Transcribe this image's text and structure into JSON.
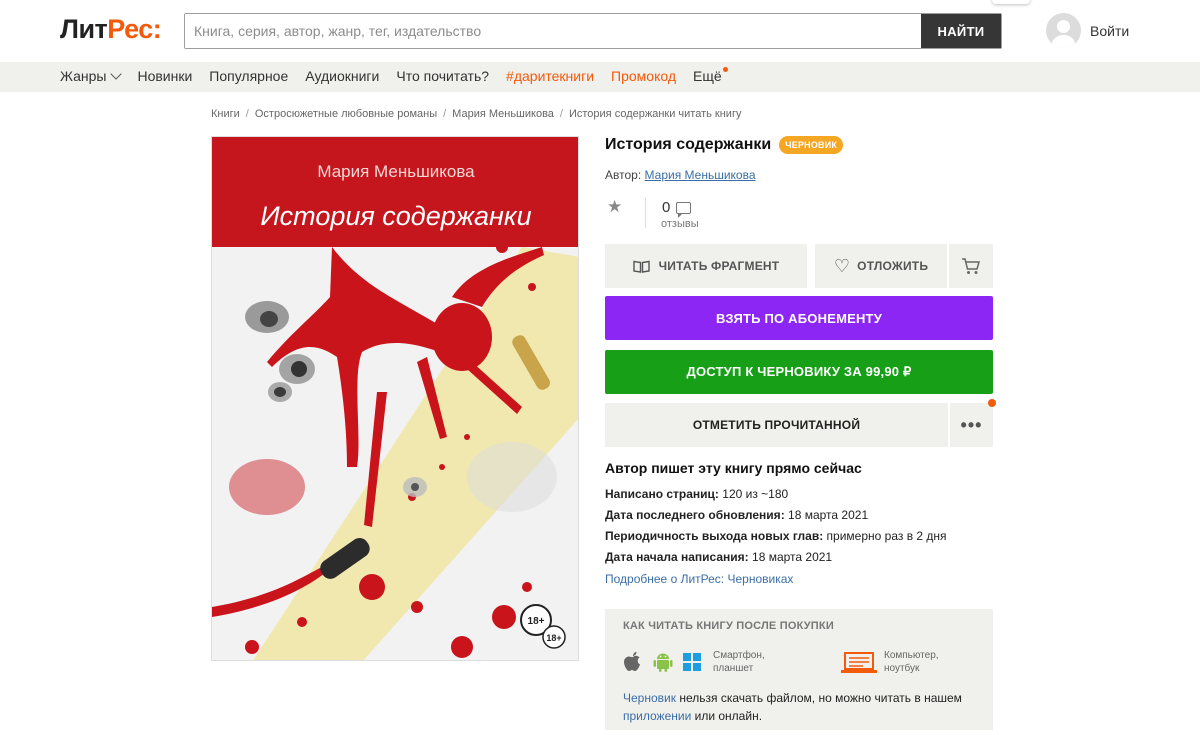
{
  "header": {
    "logo_left": "Лит",
    "logo_right": "Рес:",
    "search_placeholder": "Книга, серия, автор, жанр, тег, издательство",
    "search_button": "НАЙТИ",
    "login": "Войти"
  },
  "nav": {
    "items": [
      "Жанры",
      "Новинки",
      "Популярное",
      "Аудиокниги",
      "Что почитать?",
      "#даритекниги",
      "Промокод",
      "Ещё"
    ]
  },
  "breadcrumb": [
    "Книги",
    "Остросюжетные любовные романы",
    "Мария Меньшикова",
    "История содержанки читать книгу"
  ],
  "cover": {
    "author": "Мария Меньшикова",
    "title": "История содержанки",
    "age": "18+",
    "age2": "18+",
    "colors": {
      "red": "#c4161c",
      "blood": "#c8141a",
      "beam": "#f1e6a5"
    }
  },
  "book": {
    "title": "История содержанки",
    "badge": "ЧЕРНОВИК",
    "author_label": "Автор:",
    "author": "Мария Меньшикова",
    "reviews_count": "0",
    "reviews_label": "отзывы"
  },
  "actions": {
    "read_fragment": "ЧИТАТЬ ФРАГМЕНТ",
    "postpone": "ОТЛОЖИТЬ",
    "subscribe": "ВЗЯТЬ ПО АБОНЕМЕНТУ",
    "buy": "ДОСТУП К ЧЕРНОВИКУ ЗА 99,90 ₽",
    "mark_read": "ОТМЕТИТЬ ПРОЧИТАННОЙ",
    "more": "•••"
  },
  "writing": {
    "heading": "Автор пишет эту книгу прямо сейчас",
    "pages_label": "Написано страниц:",
    "pages_value": "120 из ~180",
    "updated_label": "Дата последнего обновления:",
    "updated_value": "18 марта 2021",
    "frequency_label": "Периодичность выхода новых глав:",
    "frequency_value": "примерно раз в 2 дня",
    "started_label": "Дата начала написания:",
    "started_value": "18 марта 2021",
    "more_link": "Подробнее о ЛитРес: Черновиках"
  },
  "howto": {
    "title": "КАК ЧИТАТЬ КНИГУ ПОСЛЕ ПОКУПКИ",
    "mobile_line1": "Смартфон,",
    "mobile_line2": "планшет",
    "desktop_line1": "Компьютер,",
    "desktop_line2": "ноутбук",
    "note_link1": "Черновик",
    "note_mid": "нельзя скачать файлом, но можно читать в нашем",
    "note_link2": "приложении",
    "note_end": "или онлайн."
  },
  "colors": {
    "accent_orange": "#f25a0c",
    "subscribe_purple": "#8c26f5",
    "buy_green": "#17a017",
    "badge": "#f5a623",
    "link": "#3a6ea5"
  }
}
